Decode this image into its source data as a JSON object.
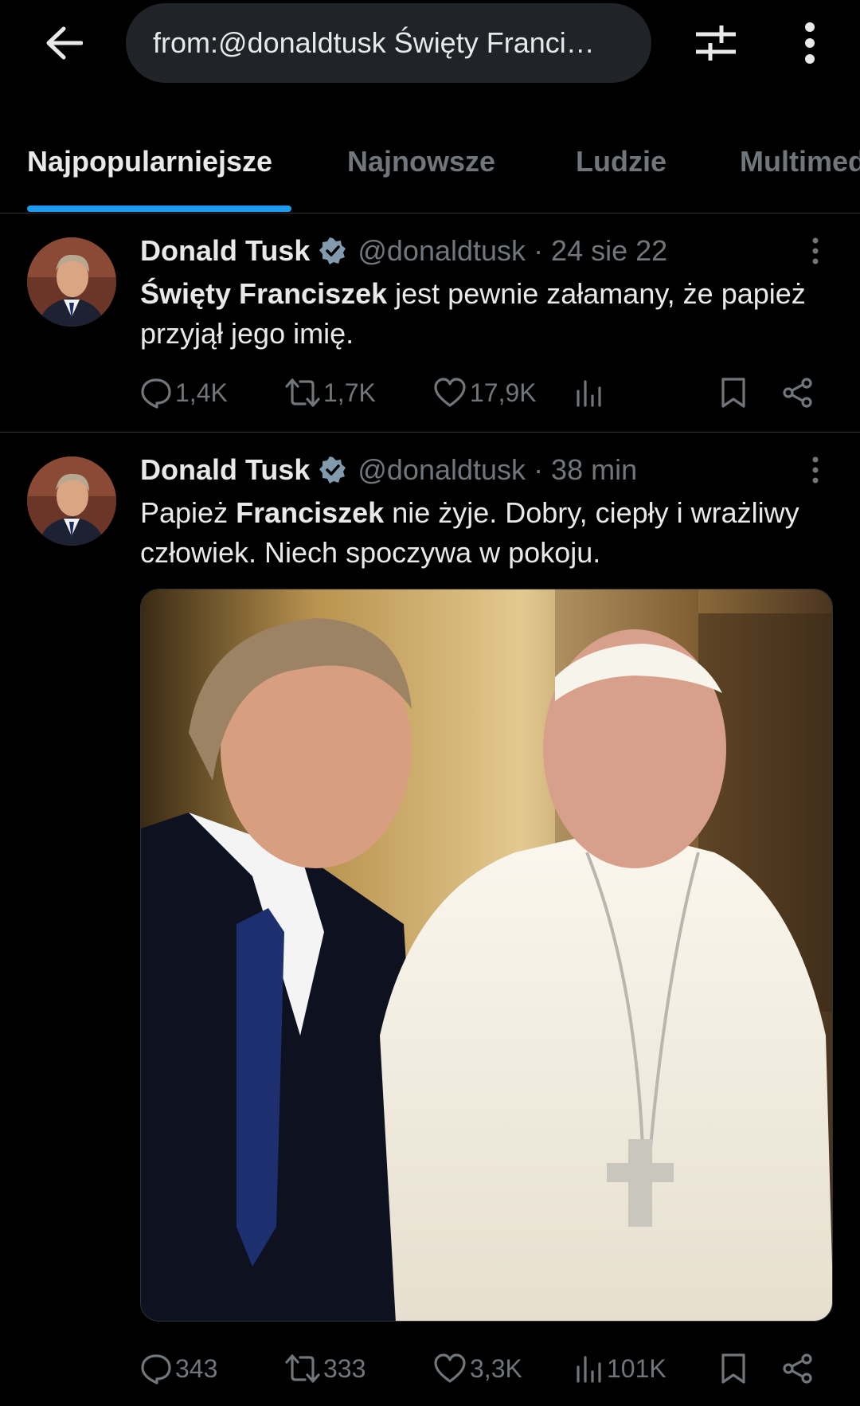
{
  "search": {
    "query": "from:@donaldtusk Święty Franci…"
  },
  "tabs": [
    {
      "label": "Najpopularniejsze",
      "active": true
    },
    {
      "label": "Najnowsze",
      "active": false
    },
    {
      "label": "Ludzie",
      "active": false
    },
    {
      "label": "Multimedia",
      "active": false
    }
  ],
  "tweets": [
    {
      "author": "Donald Tusk",
      "handle": "@donaldtusk",
      "time": "· 24 sie 22",
      "text_bold_1": "Święty Franciszek",
      "text_1": " jest pewnie załamany, że papież przyjął jego imię.",
      "replies": "1,4K",
      "reposts": "1,7K",
      "likes": "17,9K",
      "views": ""
    },
    {
      "author": "Donald Tusk",
      "handle": "@donaldtusk",
      "time": "· 38 min",
      "text_1": "Papież ",
      "text_bold_1": "Franciszek",
      "text_2": " nie żyje. Dobry, ciepły i wrażliwy człowiek. Niech spoczywa w pokoju.",
      "replies": "343",
      "reposts": "333",
      "likes": "3,3K",
      "views": "101K"
    }
  ],
  "icons": {
    "back": "arrow-left-icon",
    "filter": "sliders-icon",
    "more": "more-vertical-icon",
    "verified": "verified-badge-icon",
    "reply": "reply-icon",
    "repost": "repost-icon",
    "like": "heart-icon",
    "views": "views-icon",
    "bookmark": "bookmark-icon",
    "share": "share-icon"
  },
  "colors": {
    "background": "#000000",
    "accent": "#1d9bf0",
    "muted": "#71767b",
    "text": "#e7e9ea"
  }
}
